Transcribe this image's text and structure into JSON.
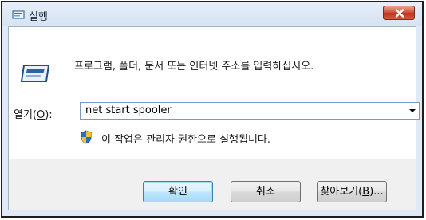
{
  "window": {
    "title": "실행",
    "title_icon": "run-window-icon",
    "close_icon": "close-x-icon"
  },
  "dialog": {
    "description": "프로그램, 폴더, 문서 또는 인터넷 주소를 입력하십시오.",
    "open_label_prefix": "열기(",
    "open_label_accel": "O",
    "open_label_suffix": "):",
    "command_value": "net start spooler",
    "admin_note": "이 작업은 관리자 권한으로 실행됩니다.",
    "run_icon": "run-program-icon",
    "shield_icon": "uac-shield-icon"
  },
  "buttons": {
    "ok": "확인",
    "cancel": "취소",
    "browse_prefix": "찾아보기(",
    "browse_accel": "B",
    "browse_suffix": ")..."
  },
  "colors": {
    "frame": "#dfeaf6",
    "close_button": "#c0331d",
    "default_button_border": "#3c7fb1"
  }
}
